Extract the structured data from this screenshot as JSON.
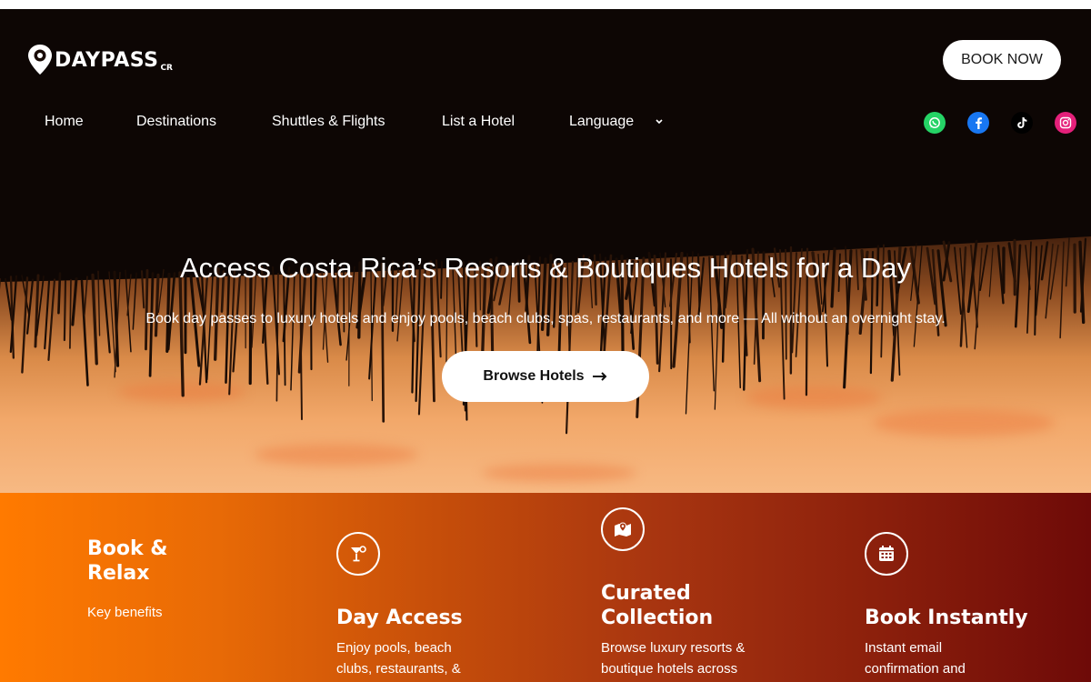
{
  "brand": {
    "logo_text": "DAYPASS",
    "logo_suffix": "CR"
  },
  "header": {
    "book_now_label": "BOOK NOW"
  },
  "nav": {
    "items": [
      {
        "label": "Home"
      },
      {
        "label": "Destinations"
      },
      {
        "label": "Shuttles & Flights"
      },
      {
        "label": "List a Hotel"
      },
      {
        "label": "Language"
      }
    ]
  },
  "social": [
    {
      "icon": "whatsapp-icon",
      "color": "#25d366"
    },
    {
      "icon": "facebook-icon",
      "color": "#1877f2"
    },
    {
      "icon": "tiktok-icon",
      "color": "#000000"
    },
    {
      "icon": "instagram-icon",
      "color": "#e4207a"
    }
  ],
  "hero": {
    "title": "Access Costa Rica’s Resorts & Boutiques Hotels for a Day",
    "subtitle": "Book day passes to luxury hotels and enjoy pools, beach clubs, spas, restaurants, and more — All without an overnight stay.",
    "cta_label": "Browse Hotels",
    "cta_icon": "arrow-right-icon"
  },
  "benefits": {
    "heading_line1": "Book &",
    "heading_line2": "Relax",
    "subheading": "Key benefits",
    "cards": [
      {
        "icon": "cocktail-icon",
        "title": "Day Access",
        "text_line1": "Enjoy pools, beach",
        "text_line2": "clubs, restaurants, &"
      },
      {
        "icon": "map-pin-icon",
        "title_line1": "Curated",
        "title_line2": "Collection",
        "text_line1": "Browse luxury resorts &",
        "text_line2": "boutique hotels across"
      },
      {
        "icon": "calendar-icon",
        "title": "Book Instantly",
        "text_line1": "Instant email",
        "text_line2": "confirmation and"
      }
    ]
  },
  "colors": {
    "accent_start": "#ff7a00",
    "accent_end": "#6e0a08"
  }
}
